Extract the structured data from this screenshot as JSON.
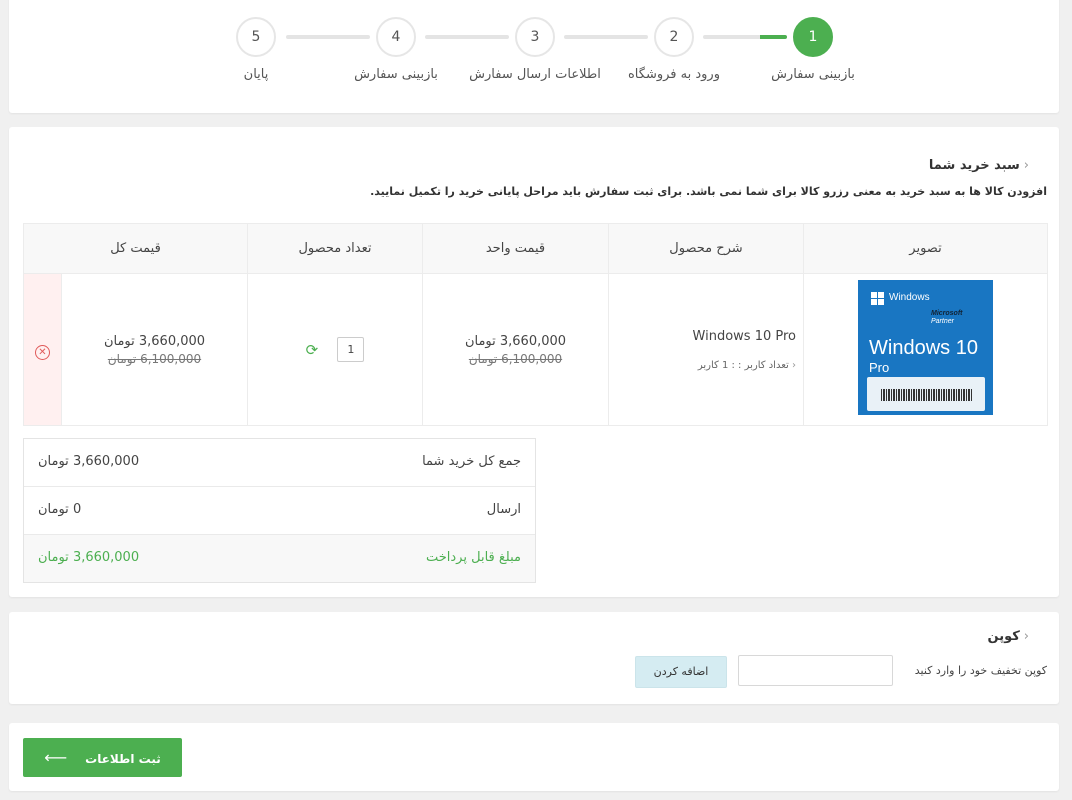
{
  "stepper": {
    "steps": [
      {
        "num": "1",
        "label": "بازبینی سفارش",
        "active": true
      },
      {
        "num": "2",
        "label": "ورود به فروشگاه",
        "active": false
      },
      {
        "num": "3",
        "label": "اطلاعات ارسال سفارش",
        "active": false
      },
      {
        "num": "4",
        "label": "بازبینی سفارش",
        "active": false
      },
      {
        "num": "5",
        "label": "پایان",
        "active": false
      }
    ]
  },
  "cart": {
    "title": "سبد خرید شما",
    "note": "افزودن کالا ها به سبد خرید به معنی رزرو کالا برای شما نمی باشد. برای ثبت سفارش باید مراحل پایانی خرید را تکمیل نمایید.",
    "columns": [
      "تصویر",
      "شرح محصول",
      "قیمت واحد",
      "تعداد محصول",
      "قیمت کل"
    ],
    "item": {
      "name": "Windows 10 Pro",
      "meta": "تعداد کاربر : : 1 کاربر",
      "unit_price": "3,660,000 تومان",
      "unit_price_old": "6,100,000 تومان",
      "quantity": "1",
      "total_price": "3,660,000 تومان",
      "total_price_old": "6,100,000 تومان",
      "image": {
        "brand": "Windows",
        "partner_line1": "Microsoft",
        "partner_line2": "Partner",
        "product": "Windows 10",
        "edition": "Pro"
      }
    },
    "totals": {
      "subtotal_label": "جمع کل خرید شما",
      "subtotal_value": "3,660,000 تومان",
      "shipping_label": "ارسال",
      "shipping_value": "0 تومان",
      "payable_label": "مبلغ قابل پرداخت",
      "payable_value": "3,660,000 تومان"
    }
  },
  "coupon": {
    "title": "کوپن",
    "hint": "کوپن تخفیف خود را وارد کنید",
    "input_value": "",
    "button": "اضافه کردن"
  },
  "submit": {
    "label": "ثبت اطلاعات"
  },
  "colors": {
    "accent": "#4caf50",
    "danger": "#e05a5a",
    "coupon_button": "#d5ecf2",
    "windows_blue": "#1976c2"
  }
}
